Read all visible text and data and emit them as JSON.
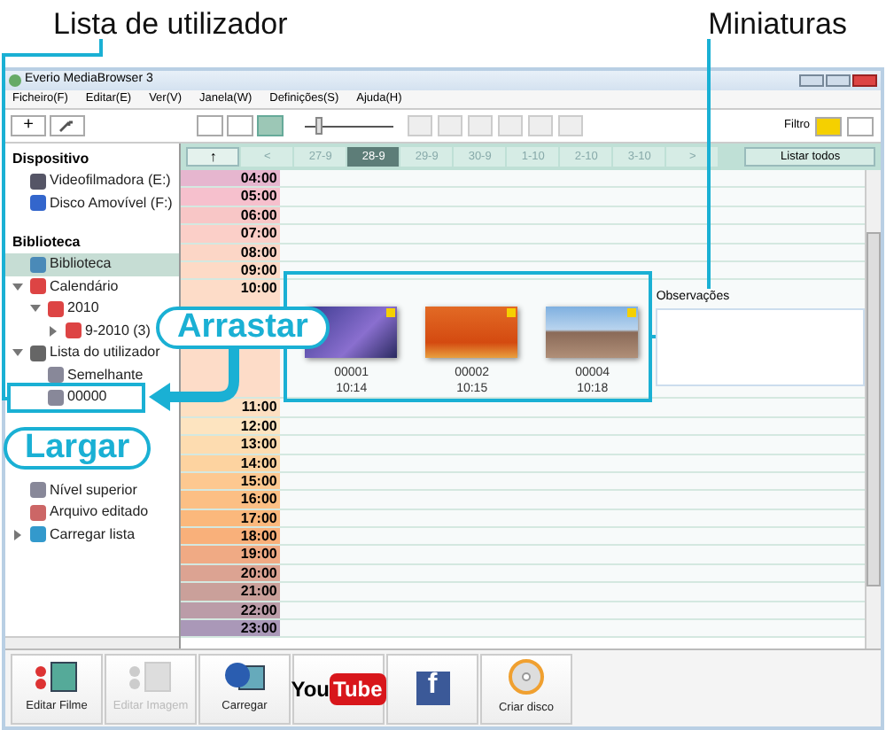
{
  "annotations": [
    {
      "kind": "heading",
      "text": "Lista de utilizador"
    },
    {
      "kind": "heading",
      "text": "Miniaturas"
    },
    {
      "kind": "callout",
      "text": "Arrastar"
    },
    {
      "kind": "callout",
      "text": "Largar"
    }
  ],
  "window": {
    "title": "Everio MediaBrowser 3"
  },
  "menu": [
    "Ficheiro(F)",
    "Editar(E)",
    "Ver(V)",
    "Janela(W)",
    "Definições(S)",
    "Ajuda(H)"
  ],
  "toolbar": {
    "add_button": "+",
    "view_modes": [
      {
        "selected": false
      },
      {
        "selected": false
      },
      {
        "selected": true
      }
    ],
    "zoom": {
      "level": 0.12
    },
    "filter_label": "Filtro"
  },
  "sidebar": {
    "sections": [
      {
        "heading": "Dispositivo",
        "items": [
          {
            "label": "Videofilmadora (E:)",
            "kind": "camera",
            "selected": false
          },
          {
            "label": "Disco Amovível (F:)",
            "kind": "disk",
            "selected": false
          }
        ]
      },
      {
        "heading": "Biblioteca",
        "items": [
          {
            "label": "Biblioteca",
            "kind": "library",
            "selected": true
          },
          {
            "label": "Calendário",
            "kind": "calendar",
            "selected": false,
            "expanded": true,
            "children": [
              {
                "label": "2010",
                "kind": "calendar",
                "selected": false,
                "expanded": true,
                "children": [
                  {
                    "label": "9-2010 (3)",
                    "kind": "calendar",
                    "selected": false,
                    "expanded": false
                  }
                ]
              }
            ]
          },
          {
            "label": "Lista do utilizador",
            "kind": "list",
            "selected": false,
            "expanded": true,
            "children": [
              {
                "label": "Semelhante",
                "kind": "folder",
                "selected": false
              },
              {
                "label": "00000",
                "kind": "folder",
                "selected": false
              }
            ]
          },
          {
            "label": "Nível superior",
            "kind": "folder",
            "selected": false
          },
          {
            "label": "Arquivo editado",
            "kind": "edit",
            "selected": false
          },
          {
            "label": "Carregar lista",
            "kind": "globe",
            "selected": false,
            "expanded": false
          }
        ]
      }
    ]
  },
  "date_bar": {
    "up_button": "↑",
    "tabs": [
      {
        "label": "<",
        "selected": false
      },
      {
        "label": "27-9",
        "selected": false
      },
      {
        "label": "28-9",
        "selected": true
      },
      {
        "label": "29-9",
        "selected": false
      },
      {
        "label": "30-9",
        "selected": false
      },
      {
        "label": "1-10",
        "selected": false
      },
      {
        "label": "2-10",
        "selected": false
      },
      {
        "label": "3-10",
        "selected": false
      },
      {
        "label": ">",
        "selected": false
      }
    ],
    "show_all_button": "Listar todos"
  },
  "timeline": {
    "hours": [
      "04:00",
      "05:00",
      "06:00",
      "07:00",
      "08:00",
      "09:00",
      "10:00",
      "11:00",
      "12:00",
      "13:00",
      "14:00",
      "15:00",
      "16:00",
      "17:00",
      "18:00",
      "19:00",
      "20:00",
      "21:00",
      "22:00",
      "23:00"
    ],
    "thumbnails": [
      {
        "name": "00001",
        "time": "10:14",
        "kind": "palm"
      },
      {
        "name": "00002",
        "time": "10:15",
        "kind": "plane"
      },
      {
        "name": "00004",
        "time": "10:18",
        "kind": "pyramid"
      }
    ],
    "notes_label": "Observações"
  },
  "actions": [
    {
      "kind": "movie",
      "label": "Editar Filme",
      "disabled": false
    },
    {
      "kind": "image",
      "label": "Editar Imagem",
      "disabled": true
    },
    {
      "kind": "upload",
      "label": "Carregar",
      "disabled": false
    },
    {
      "kind": "youtube",
      "logo": [
        "You",
        "Tube"
      ]
    },
    {
      "kind": "facebook",
      "logo": "f"
    },
    {
      "kind": "disc",
      "label": "Criar disco",
      "disabled": false
    }
  ]
}
